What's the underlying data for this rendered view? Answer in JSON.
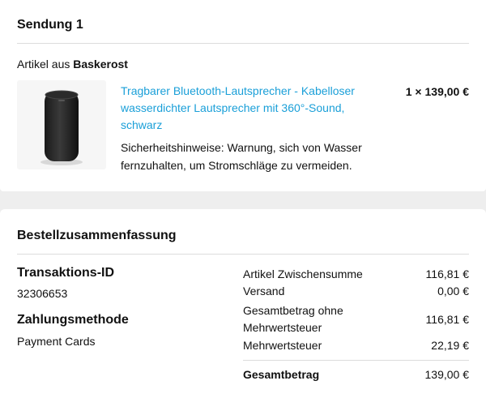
{
  "shipment": {
    "title": "Sendung 1",
    "seller_prefix": "Artikel aus",
    "seller_name": "Baskerost",
    "product": {
      "image": "bluetooth-speaker-image",
      "title": "Tragbarer Bluetooth-Lautsprecher - Kabelloser wasserdichter Lautsprecher mit 360°-Sound, schwarz",
      "qty_price": "1 × 139,00 €",
      "safety_note": "Sicherheitshinweise: Warnung, sich von Wasser fernzuhalten, um Stromschläge zu vermeiden."
    }
  },
  "summary": {
    "title": "Bestellzusammenfassung",
    "transaction_label": "Transaktions-ID",
    "transaction_id": "32306653",
    "payment_label": "Zahlungsmethode",
    "payment_value": "Payment Cards",
    "rows": [
      {
        "label": "Artikel Zwischensumme",
        "amount": "116,81 €"
      },
      {
        "label": "Versand",
        "amount": "0,00 €"
      },
      {
        "label": "Gesamtbetrag ohne Mehrwertsteuer",
        "amount": "116,81 €"
      },
      {
        "label": "Mehrwertsteuer",
        "amount": "22,19 €"
      }
    ],
    "total": {
      "label": "Gesamtbetrag",
      "amount": "139,00 €"
    }
  },
  "colors": {
    "link": "#1a9fd8",
    "page_background": "#eeeeee"
  }
}
